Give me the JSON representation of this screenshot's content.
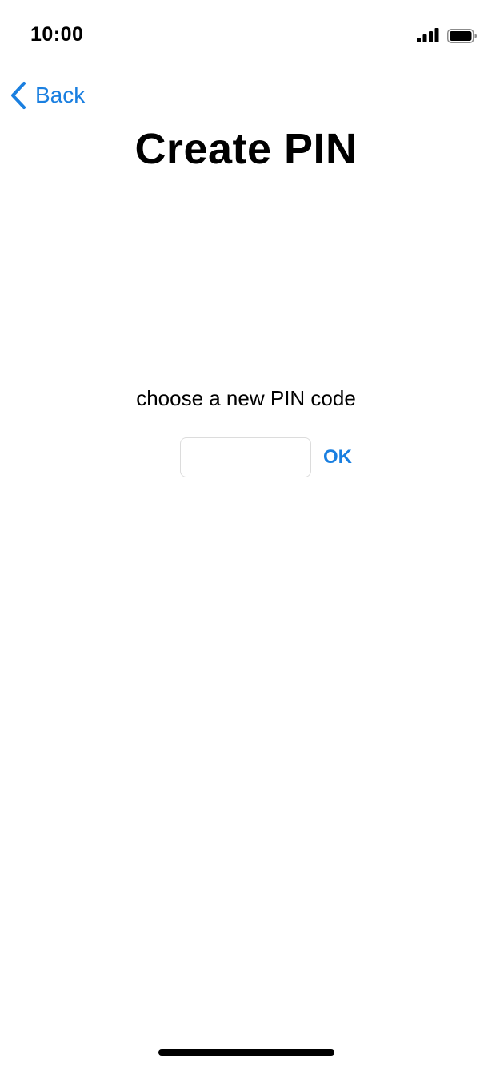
{
  "status_bar": {
    "time": "10:00",
    "signal_icon": "cellular-signal-icon",
    "battery_icon": "battery-full-icon"
  },
  "nav": {
    "back_label": "Back",
    "back_icon": "chevron-left-icon"
  },
  "title": "Create PIN",
  "pin_form": {
    "prompt": "choose a new PIN code",
    "input_value": "",
    "ok_label": "OK"
  },
  "colors": {
    "accent": "#1a7fe0",
    "text": "#000000",
    "background": "#ffffff",
    "input_border": "#dcdcdc"
  }
}
